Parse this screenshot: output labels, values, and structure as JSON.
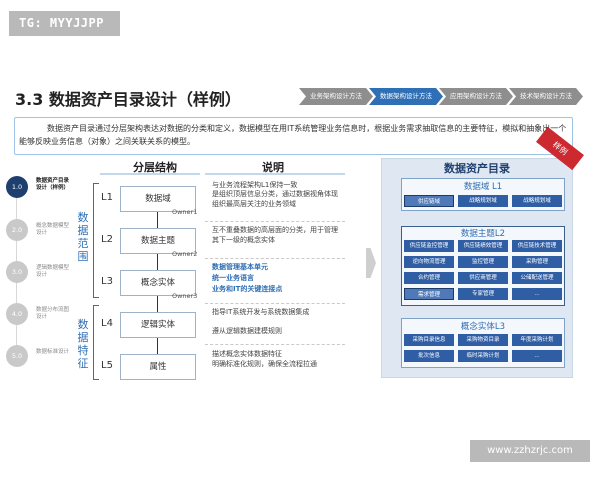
{
  "watermark": "TG: MYYJJPP",
  "title": "3.3 数据资产目录设计（样例）",
  "tabs": [
    {
      "label": "业务架构设计方法",
      "active": false
    },
    {
      "label": "数据架构设计方法",
      "active": true
    },
    {
      "label": "应用架构设计方法",
      "active": false
    },
    {
      "label": "技术架构设计方法",
      "active": false
    }
  ],
  "intro": "数据资产目录通过分层架构表达对数据的分类和定义，数据模型在用IT系统管理业务信息时，根据业务需求抽取信息的主要特征，模拟和抽象出一个能够反映业务信息（对象）之间关联关系的模型。",
  "steps": [
    {
      "num": "1.0",
      "label": "数据资产目录设计（样例）",
      "active": true
    },
    {
      "num": "2.0",
      "label": "概念数据模型设计",
      "active": false
    },
    {
      "num": "3.0",
      "label": "逻辑数据模型设计",
      "active": false
    },
    {
      "num": "4.0",
      "label": "数据分布流图设计",
      "active": false
    },
    {
      "num": "5.0",
      "label": "数据标准设计",
      "active": false
    }
  ],
  "group_labels": {
    "scope": "数据范围",
    "feature": "数据特征"
  },
  "headers": {
    "layers": "分层结构",
    "explain": "说明"
  },
  "levels": [
    {
      "code": "L1",
      "name": "数据域"
    },
    {
      "code": "L2",
      "name": "数据主题"
    },
    {
      "code": "L3",
      "name": "概念实体"
    },
    {
      "code": "L4",
      "name": "逻辑实体"
    },
    {
      "code": "L5",
      "name": "属性"
    }
  ],
  "owners": [
    "Owner1",
    "Owner2",
    "Owner3"
  ],
  "descriptions": [
    [
      "与业务流程架构L1保持一致",
      "是组织顶层信息分类，通过数据视角体现组织最高层关注的业务领域"
    ],
    [
      "互不重叠数据的高层面的分类，用于管理其下一级的概念实体"
    ],
    [
      "数据管理基本单元",
      "统一业务语言",
      "业务和IT的关键连接点"
    ],
    [
      "指导IT系统开发与系统数据集成",
      "遵从逻辑数据建模规则"
    ],
    [
      "描述概念实体数据特征",
      "明确标准化规则，确保全流程拉通"
    ]
  ],
  "catalog": {
    "title": "数据资产目录",
    "ribbon": "样例",
    "l1": {
      "title": "数据域 L1",
      "items": [
        "供应链域",
        "战略规划域",
        "战略规划域"
      ]
    },
    "l2": {
      "title": "数据主题L2",
      "items": [
        "供应链监控管理",
        "供应链绩效管理",
        "供应链技术管理",
        "逆向物流管理",
        "监控管理",
        "采购管理",
        "合约管理",
        "供应商管理",
        "公储配送管理",
        "需求管理",
        "专家管理",
        "..."
      ]
    },
    "l3": {
      "title": "概念实体L3",
      "items": [
        "采购目录信息",
        "采购物资目录",
        "年度采购计划",
        "批次信息",
        "临时采购计划",
        "..."
      ]
    }
  },
  "url": "www.zzhzrjc.com"
}
